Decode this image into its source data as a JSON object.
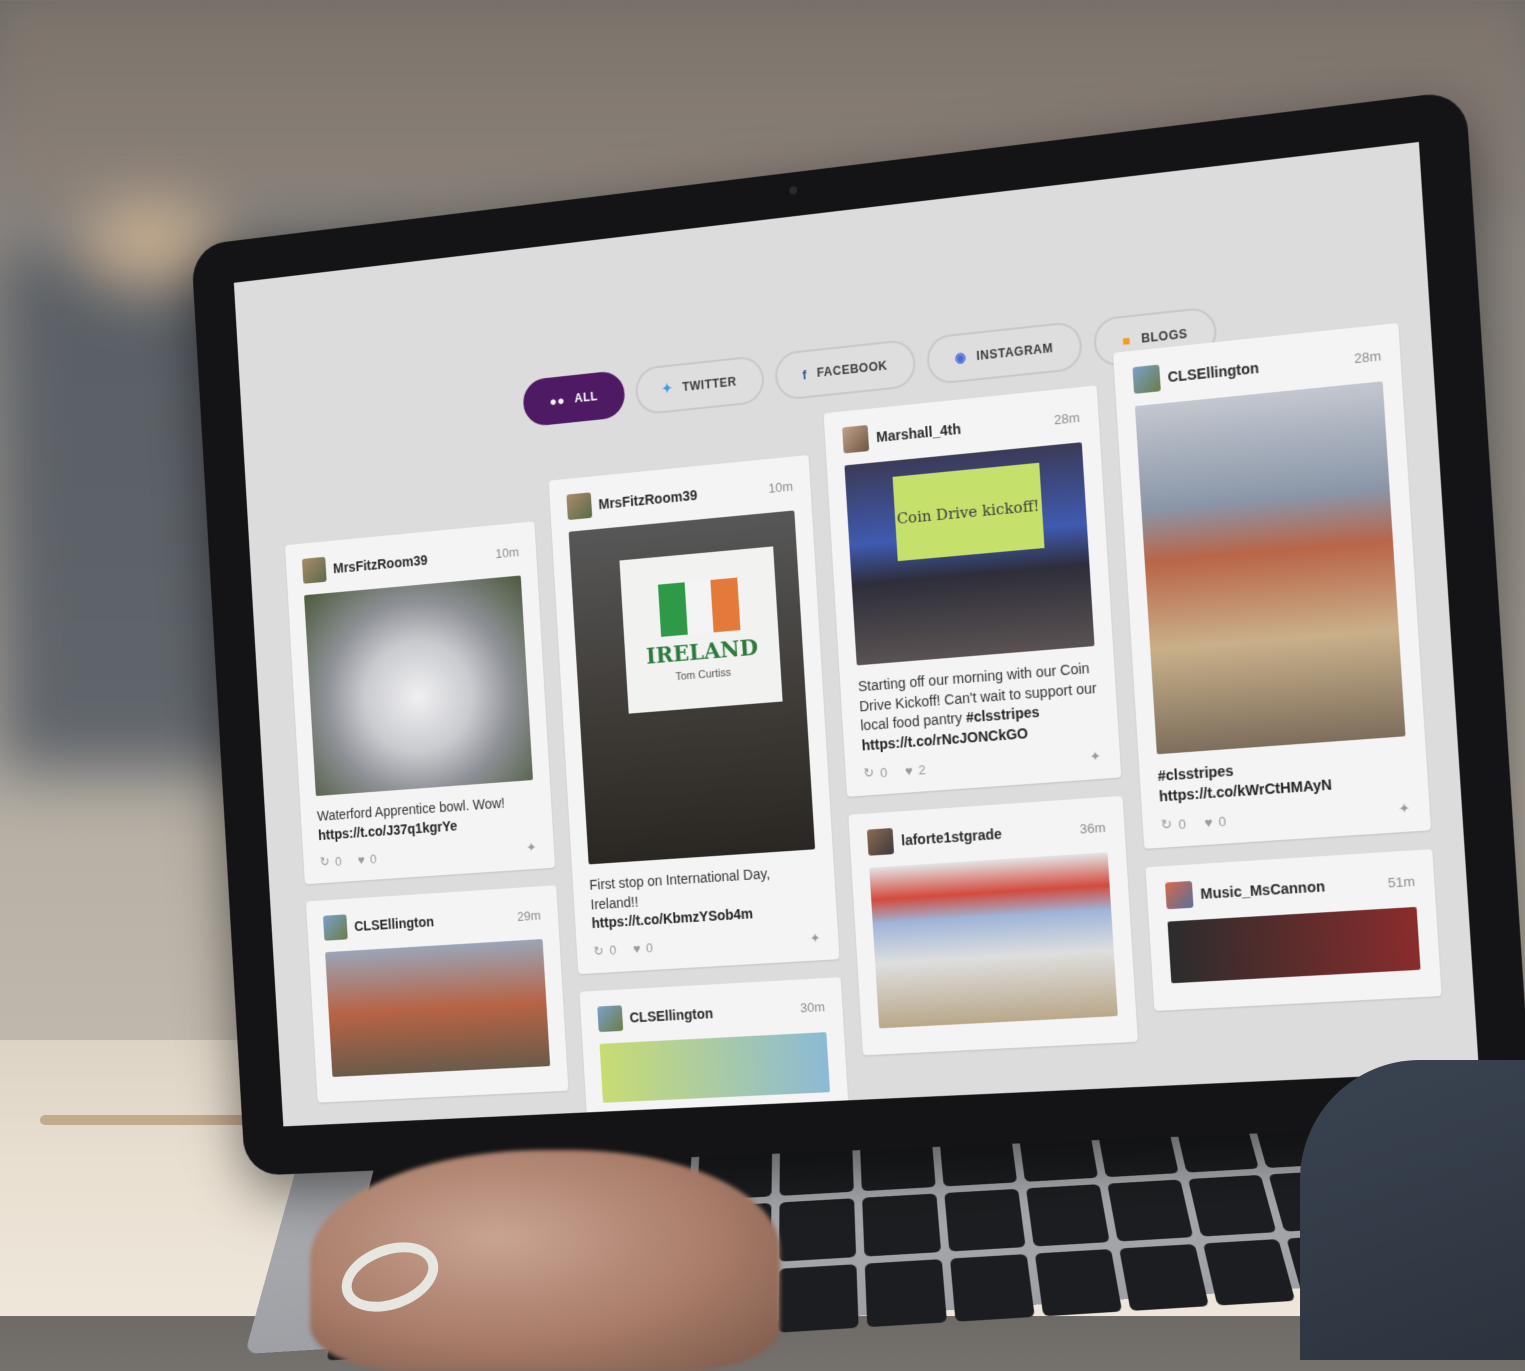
{
  "filters": [
    {
      "label": "ALL",
      "icon": "users-icon",
      "active": true
    },
    {
      "label": "TWITTER",
      "icon": "twitter-icon",
      "active": false
    },
    {
      "label": "FACEBOOK",
      "icon": "facebook-icon",
      "active": false
    },
    {
      "label": "INSTAGRAM",
      "icon": "instagram-icon",
      "active": false
    },
    {
      "label": "BLOGS",
      "icon": "blogger-icon",
      "active": false
    }
  ],
  "posts": {
    "c1p1": {
      "user": "MrsFitzRoom39",
      "time": "10m",
      "text": "Waterford Apprentice bowl. Wow!",
      "link": "https://t.co/J37q1kgrYe",
      "retweets": "0",
      "likes": "0"
    },
    "c1p2": {
      "user": "CLSEllington",
      "time": "29m"
    },
    "c2p1": {
      "user": "MrsFitzRoom39",
      "time": "10m",
      "text": "First stop on International Day, Ireland!!",
      "link": "https://t.co/KbmzYSob4m",
      "retweets": "0",
      "likes": "0"
    },
    "c2p2": {
      "user": "CLSEllington",
      "time": "30m"
    },
    "c3p1": {
      "user": "Marshall_4th",
      "time": "28m",
      "text": "Starting off our morning with our Coin Drive Kickoff! Can't wait to support our local food pantry",
      "hashtag": "#clsstripes",
      "link": "https://t.co/rNcJONCkGO",
      "retweets": "0",
      "likes": "2"
    },
    "c3p2": {
      "user": "laforte1stgrade",
      "time": "36m"
    },
    "c4p1": {
      "user": "CLSEllington",
      "time": "28m",
      "hashtag": "#clsstripes",
      "link": "https://t.co/kWrCtHMAyN",
      "retweets": "0",
      "likes": "0"
    },
    "c4p2": {
      "user": "Music_MsCannon",
      "time": "51m"
    }
  },
  "slides": {
    "ireland_title": "IRELAND",
    "ireland_sub": "Tom Curtiss",
    "coin_title": "Coin Drive kickoff!"
  },
  "colors": {
    "active_pill": "#4e1a63",
    "ireland_green": "#2e9a48",
    "ireland_white": "#f4f4f4",
    "ireland_orange": "#e37a3a"
  }
}
